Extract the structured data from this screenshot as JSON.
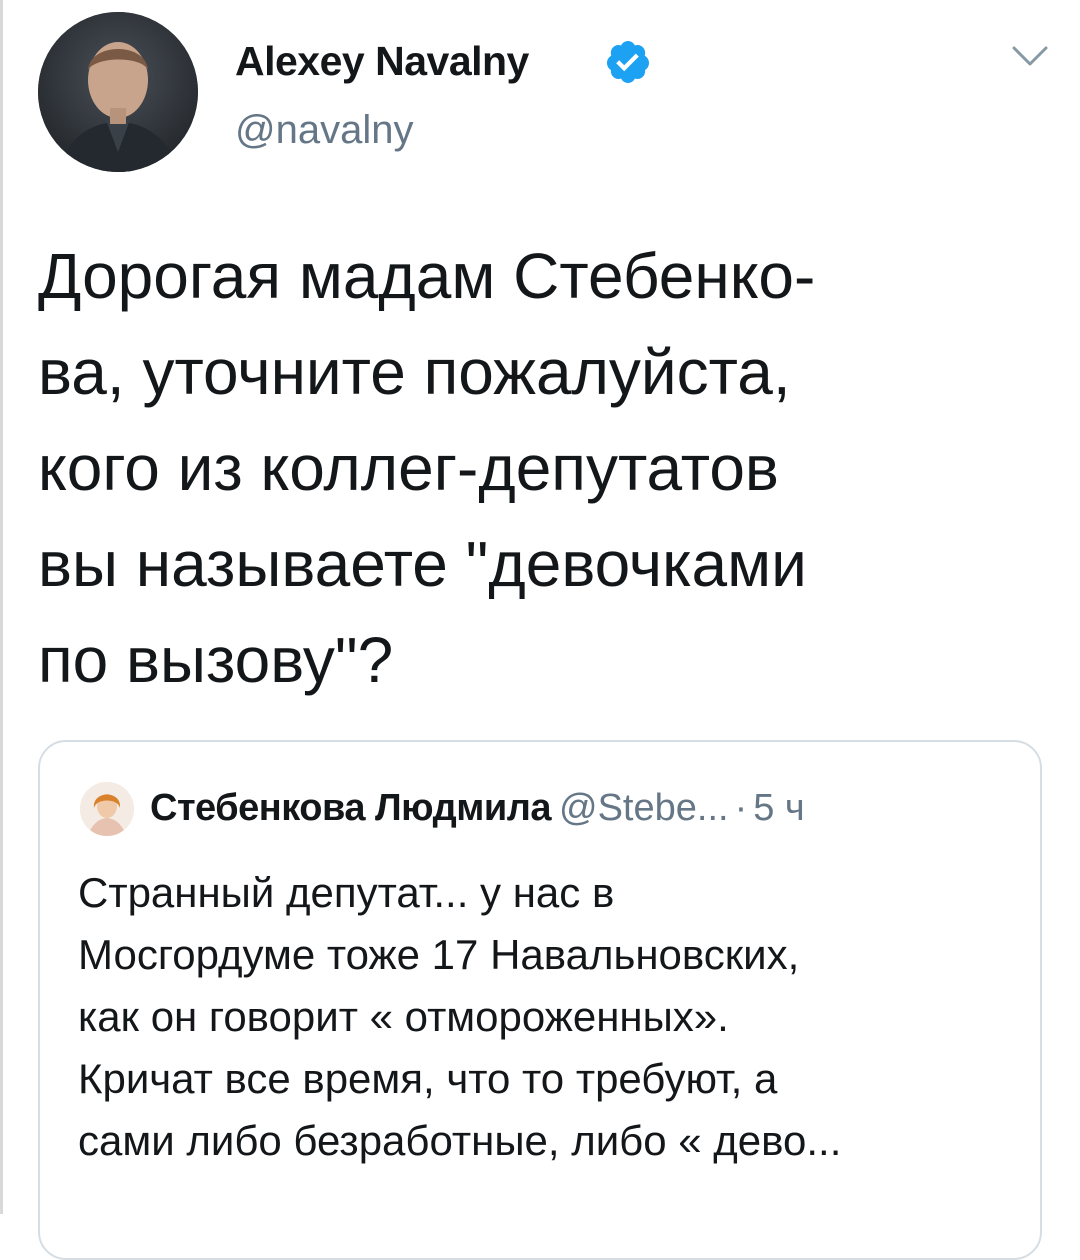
{
  "tweet": {
    "author_name": "Alexey Navalny",
    "handle": "@navalny",
    "verified_icon": "verified-badge-icon",
    "menu_icon": "chevron-down-icon",
    "text_lines": [
      "Дорогая мадам Стебенко-",
      "ва, уточните пожалуйста,",
      "кого из коллег-депутатов",
      "вы называете \"девочками",
      "по вызову\"?"
    ]
  },
  "quoted_tweet": {
    "author_name": "Стебенкова Людмила",
    "handle": "@Stebe...",
    "separator": "·",
    "time": "5 ч",
    "text_lines": [
      "Странный депутат... у нас в",
      "Мосгордуме тоже 17 Навальновских,",
      "как он говорит « отмороженных».",
      "Кричат все время, что то требуют, а",
      "сами либо безработные, либо « дево..."
    ]
  },
  "colors": {
    "text": "#14171a",
    "secondary": "#657786",
    "verified": "#1da1f2",
    "border": "#d6dde3"
  }
}
